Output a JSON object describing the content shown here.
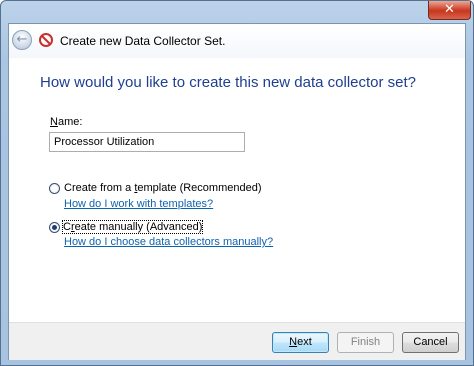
{
  "window": {
    "close_glyph": "✕",
    "title": "Create new Data Collector Set."
  },
  "question": "How would you like to create this new data collector set?",
  "name_field": {
    "label": "Name:",
    "value": "Processor Utilization"
  },
  "options": [
    {
      "label": "Create from a template (Recommended)",
      "help_link": "How do I work with templates?",
      "selected": false
    },
    {
      "label": "Create manually (Advanced)",
      "help_link": "How do I choose data collectors manually?",
      "selected": true
    }
  ],
  "buttons": {
    "next": "Next",
    "finish": "Finish",
    "cancel": "Cancel"
  },
  "colors": {
    "heading": "#1e3f8f",
    "link": "#0e63b0",
    "close_button": "#c7361f"
  },
  "icons": {
    "back": "back-arrow-icon",
    "app": "data-collector-icon",
    "close": "close-icon"
  }
}
